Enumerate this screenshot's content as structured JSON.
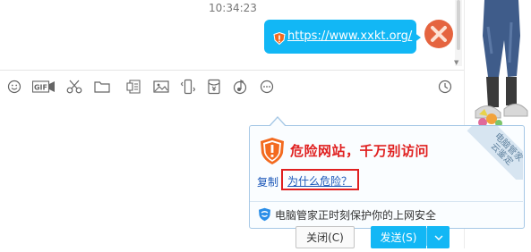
{
  "chat": {
    "timestamp": "10:34:23",
    "message_link": "https://www.xxkt.org/"
  },
  "toolbar": {
    "items": [
      "smiley-icon",
      "gif-icon",
      "scissors-icon",
      "folder-icon",
      "document-icon",
      "image-icon",
      "shake-icon",
      "red-packet-icon",
      "music-icon",
      "more-icon",
      "history-clock-icon"
    ],
    "gif_label": "GIF"
  },
  "popup": {
    "title": "危险网站，千万别访问",
    "ribbon_text": "电脑管家\n云鉴定",
    "copy_label": "复制",
    "why_label": "为什么危险？",
    "footer_text": "电脑管家正时刻保护你的上网安全"
  },
  "buttons": {
    "close_label": "关闭(C)",
    "send_label": "发送(S)"
  },
  "colors": {
    "accent": "#12b7f5",
    "danger": "#e02020",
    "link": "#1a56b8"
  }
}
